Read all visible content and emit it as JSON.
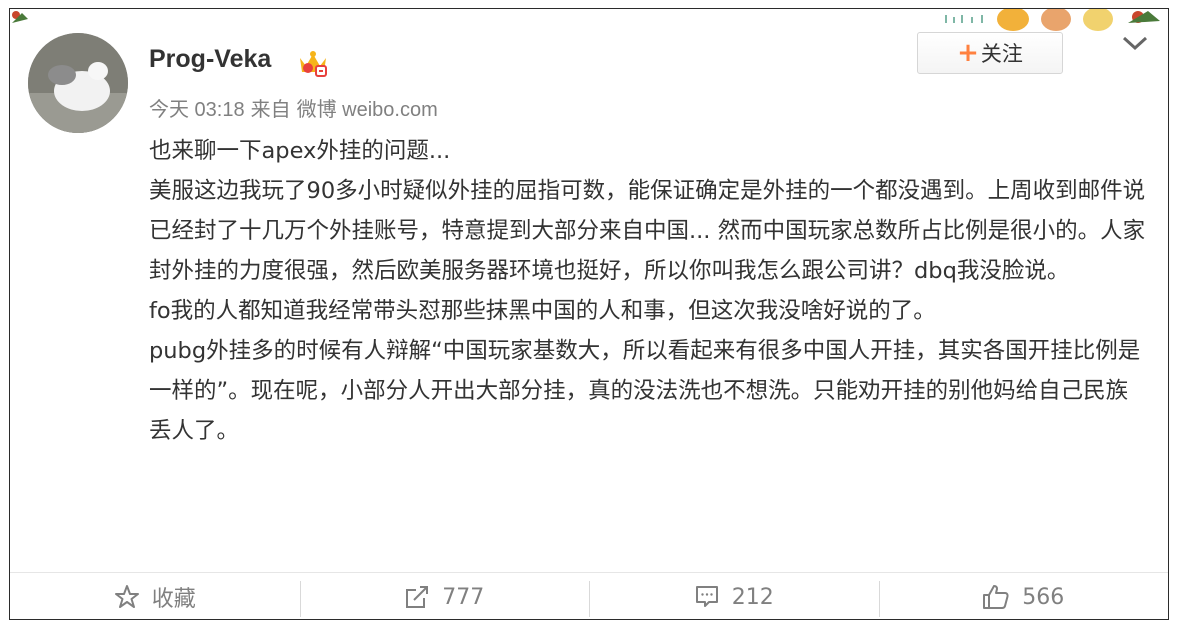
{
  "post": {
    "username": "Prog-Veka",
    "meta": {
      "time": "今天 03:18",
      "source_prefix": "来自",
      "source": "微博 weibo.com"
    },
    "follow_label": "关注",
    "paragraphs": [
      "也来聊一下apex外挂的问题...",
      "美服这边我玩了90多小时疑似外挂的屈指可数，能保证确定是外挂的一个都没遇到。上周收到邮件说已经封了十几万个外挂账号，特意提到大部分来自中国... 然而中国玩家总数所占比例是很小的。人家封外挂的力度很强，然后欧美服务器环境也挺好，所以你叫我怎么跟公司讲？dbq我没脸说。",
      "fo我的人都知道我经常带头怼那些抹黑中国的人和事，但这次我没啥好说的了。",
      "pubg外挂多的时候有人辩解“中国玩家基数大，所以看起来有很多中国人开挂，其实各国开挂比例是一样的”。现在呢，小部分人开出大部分挂，真的没法洗也不想洗。只能劝开挂的别他妈给自己民族丢人了。"
    ]
  },
  "actions": {
    "favorite_label": "收藏",
    "repost_count": "777",
    "comment_count": "212",
    "like_count": "566"
  },
  "colors": {
    "accent_orange": "#ff8140",
    "text_main": "#333333",
    "text_muted": "#808080"
  },
  "icons": [
    "crown-badge-icon",
    "plus-icon",
    "chevron-down-icon",
    "star-icon",
    "repost-icon",
    "comment-icon",
    "like-icon"
  ]
}
